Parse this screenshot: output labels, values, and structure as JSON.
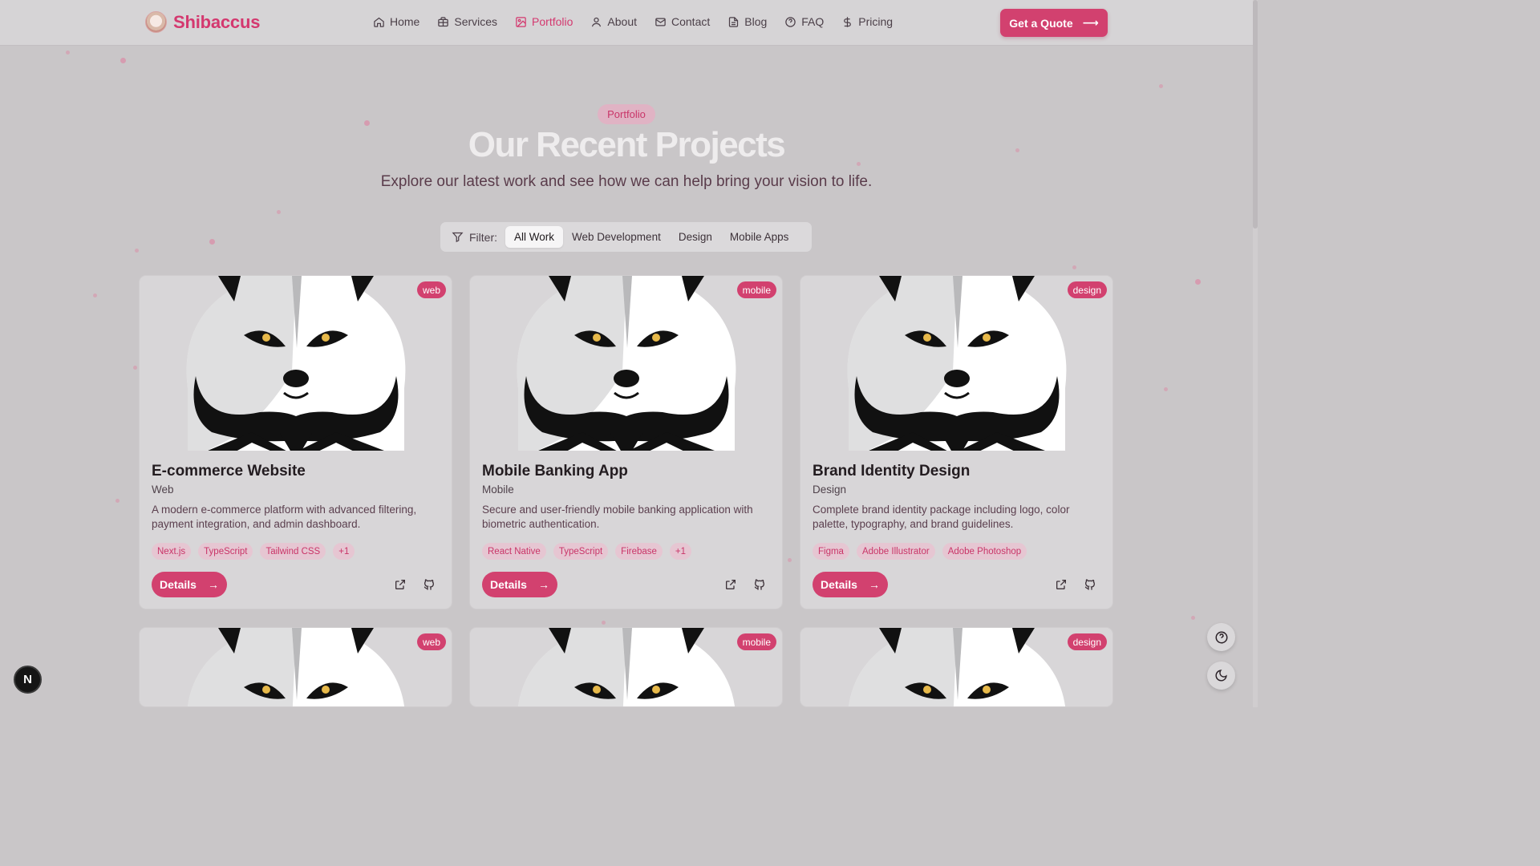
{
  "brand": {
    "name": "Shibaccus"
  },
  "nav": {
    "items": [
      {
        "label": "Home",
        "icon": "home-icon"
      },
      {
        "label": "Services",
        "icon": "briefcase-icon"
      },
      {
        "label": "Portfolio",
        "icon": "image-icon",
        "active": true
      },
      {
        "label": "About",
        "icon": "user-icon"
      },
      {
        "label": "Contact",
        "icon": "mail-icon"
      },
      {
        "label": "Blog",
        "icon": "document-icon"
      },
      {
        "label": "FAQ",
        "icon": "help-circle-icon"
      },
      {
        "label": "Pricing",
        "icon": "dollar-icon"
      }
    ],
    "cta": "Get a Quote"
  },
  "hero": {
    "badge": "Portfolio",
    "title": "Our Recent Projects",
    "subtitle": "Explore our latest work and see how we can help bring your vision to life."
  },
  "filter": {
    "label": "Filter:",
    "options": [
      "All Work",
      "Web Development",
      "Design",
      "Mobile Apps"
    ],
    "selected": "All Work"
  },
  "projects": [
    {
      "tag": "web",
      "title": "E-commerce Website",
      "category": "Web",
      "description": "A modern e-commerce platform with advanced filtering, payment integration, and admin dashboard.",
      "tech": [
        "Next.js",
        "TypeScript",
        "Tailwind CSS",
        "+1"
      ],
      "details_label": "Details"
    },
    {
      "tag": "mobile",
      "title": "Mobile Banking App",
      "category": "Mobile",
      "description": "Secure and user-friendly mobile banking application with biometric authentication.",
      "tech": [
        "React Native",
        "TypeScript",
        "Firebase",
        "+1"
      ],
      "details_label": "Details"
    },
    {
      "tag": "design",
      "title": "Brand Identity Design",
      "category": "Design",
      "description": "Complete brand identity package including logo, color palette, typography, and brand guidelines.",
      "tech": [
        "Figma",
        "Adobe Illustrator",
        "Adobe Photoshop"
      ],
      "details_label": "Details"
    },
    {
      "tag": "web"
    },
    {
      "tag": "mobile"
    },
    {
      "tag": "design"
    }
  ],
  "dev_badge": "N",
  "colors": {
    "accent": "#d2416f",
    "background": "#c9c6c8",
    "surface": "#d8d6d8"
  }
}
